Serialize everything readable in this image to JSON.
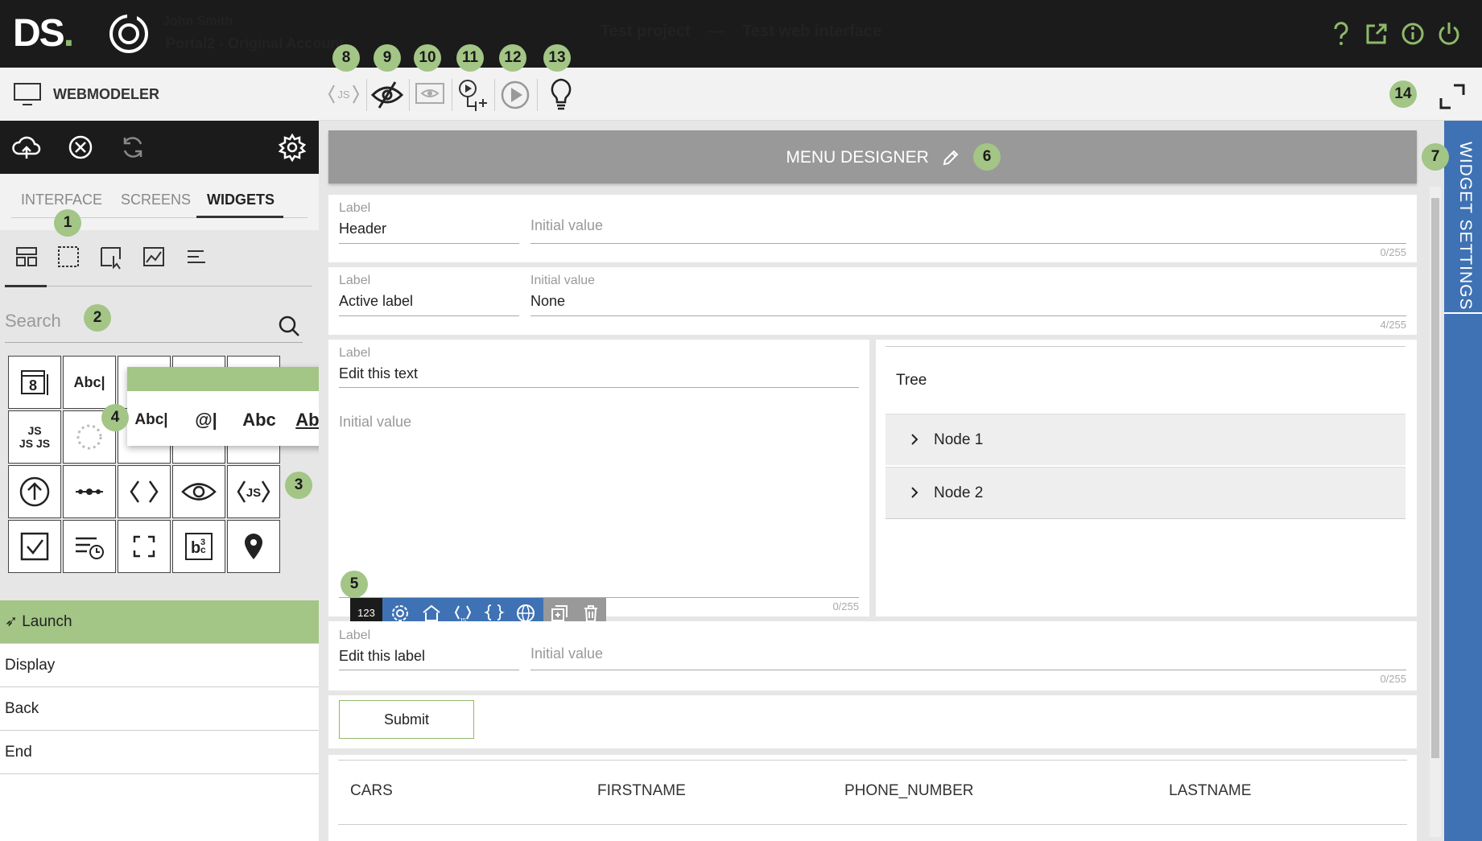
{
  "app": {
    "logo_text": "DS",
    "logo_dot": ".",
    "user_name": "John Smith",
    "account": "Portal2 - Original Account",
    "project": "Test project",
    "separator": "—",
    "interface_name": "Test web interface",
    "module_label": "WEBMODELER",
    "accent_color": "#a3c586",
    "sidebar_color": "#3f72b4"
  },
  "badges": {
    "b1": "1",
    "b2": "2",
    "b3": "3",
    "b4": "4",
    "b5": "5",
    "b6": "6",
    "b7": "7",
    "b8": "8",
    "b9": "9",
    "b10": "10",
    "b11": "11",
    "b12": "12",
    "b13": "13",
    "b14": "14"
  },
  "sidebar": {
    "tabs": [
      {
        "label": "INTERFACE"
      },
      {
        "label": "SCREENS"
      },
      {
        "label": "WIDGETS",
        "active": true
      }
    ],
    "search_placeholder": "Search",
    "widget_abc": "Abc",
    "widget_js": "JS",
    "popup_items": [
      "Abc",
      "@",
      "Abc",
      "Abc"
    ],
    "screens": [
      {
        "label": "Launch",
        "active": true
      },
      {
        "label": "Display"
      },
      {
        "label": "Back"
      },
      {
        "label": "End"
      }
    ]
  },
  "main": {
    "menu_designer": "MENU DESIGNER",
    "widget_settings": "WIDGET SETTINGS",
    "fields": [
      {
        "label": "Label",
        "value": "Header",
        "init_label": "",
        "init_placeholder": "Initial value",
        "init_value": "",
        "count": "0/255"
      },
      {
        "label": "Label",
        "value": "Active label",
        "init_label": "Initial value",
        "init_value": "None",
        "count": "4/255"
      },
      {
        "label": "Label",
        "value": "Edit this text",
        "init_placeholder": "Initial value",
        "count": "0/255"
      },
      {
        "label": "Label",
        "value": "Edit this label",
        "init_placeholder": "Initial value",
        "count": "0/255"
      }
    ],
    "toolbar_first": "123",
    "tree": {
      "title": "Tree",
      "nodes": [
        "Node 1",
        "Node 2"
      ]
    },
    "submit_label": "Submit",
    "table_headers": [
      "CARS",
      "FIRSTNAME",
      "PHONE_NUMBER",
      "LASTNAME"
    ]
  }
}
